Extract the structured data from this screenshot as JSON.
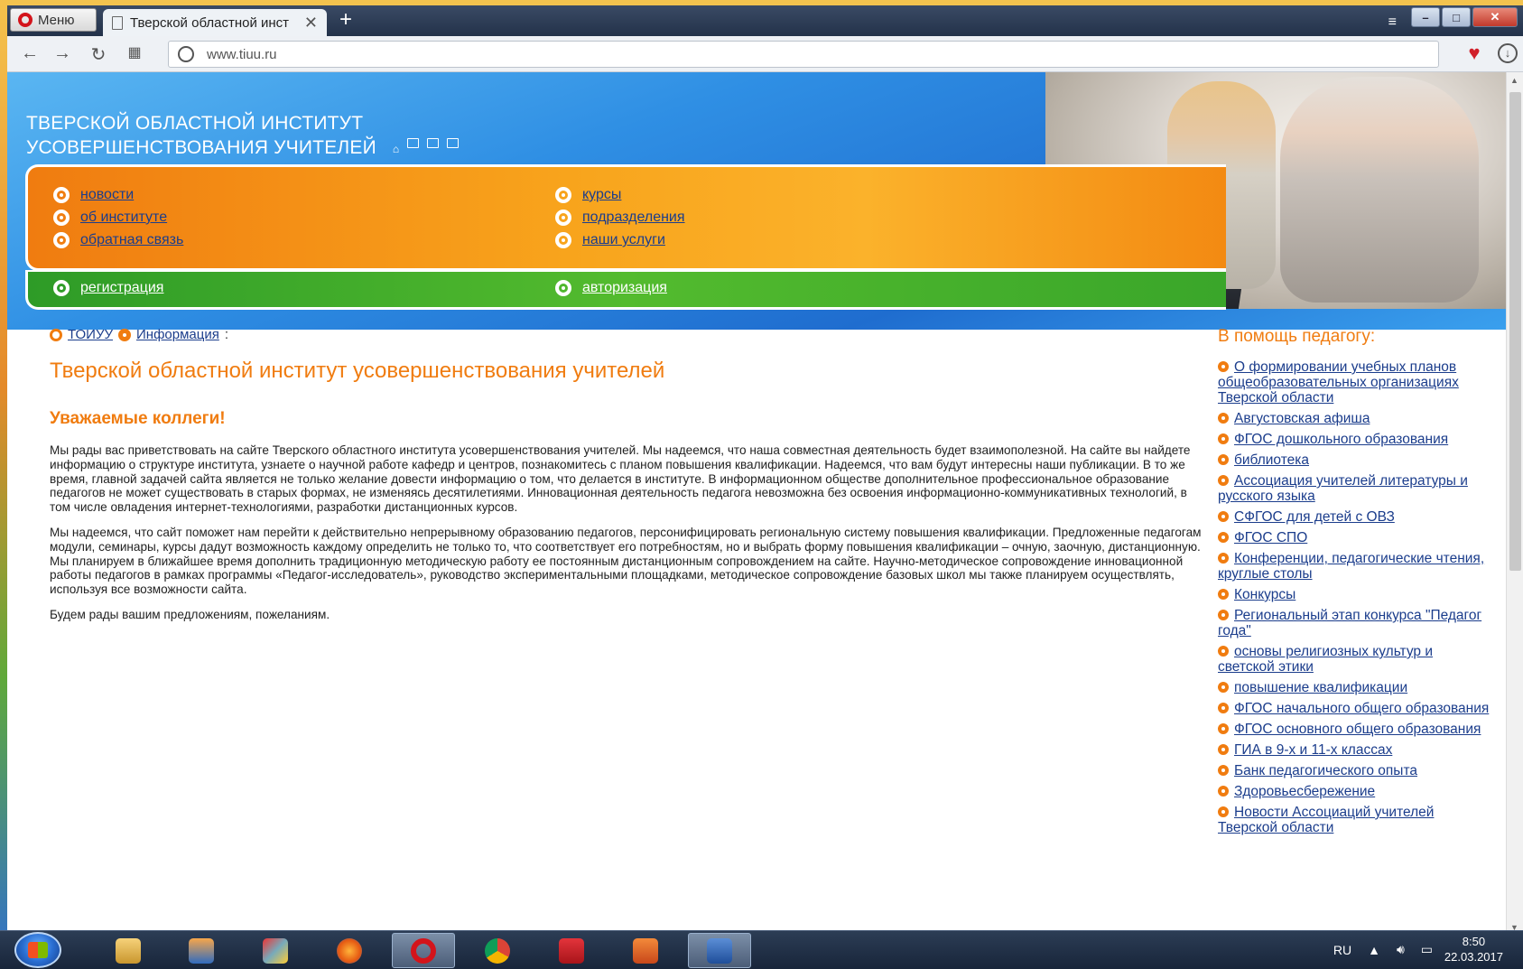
{
  "browser": {
    "menu_label": "Меню",
    "tab_title": "Тверской областной инст",
    "address": "www.tiuu.ru"
  },
  "header": {
    "title_line1": "ТВЕРСКОЙ ОБЛАСТНОЙ ИНСТИТУТ",
    "title_line2": "УСОВЕРШЕНСТВОВАНИЯ УЧИТЕЛЕЙ",
    "menu_left": [
      "новости",
      "об институте",
      "обратная связь"
    ],
    "menu_right": [
      "курсы",
      "подразделения",
      "наши услуги"
    ],
    "register": "регистрация",
    "login": "авторизация"
  },
  "breadcrumb": {
    "home": "ТОИУУ",
    "section": "Информация",
    "sep": ":"
  },
  "main": {
    "title": "Тверской областной институт усовершенствования учителей",
    "greeting": "Уважаемые коллеги!",
    "paragraphs": [
      "Мы рады вас приветствовать на сайте Тверского областного института усовершенствования учителей. Мы надеемся, что наша совместная деятельность будет взаимополезной. На сайте вы найдете информацию о структуре института, узнаете о научной работе кафедр и центров, познакомитесь с планом повышения квалификации. Надеемся, что вам будут интересны наши публикации. В то же время, главной задачей сайта является не только желание довести информацию о том, что делается в институте. В информационном обществе дополнительное профессиональное образование педагогов не может существовать в старых формах, не изменяясь десятилетиями. Инновационная деятельность педагога невозможна без освоения информационно-коммуникативных технологий, в том числе овладения интернет-технологиями, разработки дистанционных курсов.",
      "Мы надеемся, что сайт поможет нам перейти к действительно непрерывному образованию педагогов, персонифицировать региональную систему повышения квалификации. Предложенные педагогам модули, семинары, курсы дадут возможность каждому определить не только то, что соответствует его потребностям, но и выбрать форму повышения квалификации – очную, заочную, дистанционную. Мы планируем в ближайшее время дополнить традиционную методическую работу ее постоянным дистанционным сопровождением на сайте. Научно-методическое сопровождение инновационной работы педагогов в рамках программы «Педагог-исследователь», руководство экспериментальными площадками, методическое сопровождение базовых школ мы также планируем осуществлять, используя все возможности сайта.",
      "Будем рады вашим предложениям, пожеланиям."
    ]
  },
  "sidebar": {
    "title": "В помощь педагогу:",
    "items": [
      "О формировании учебных планов общеобразовательных организациях Тверской области",
      "Августовская афиша",
      "ФГОС дошкольного образования",
      "библиотека",
      "Ассоциация учителей литературы и русского языка",
      "СФГОС для детей с ОВЗ",
      "ФГОС СПО",
      "Конференции, педагогические чтения, круглые столы",
      "Конкурсы",
      "Региональный этап конкурса \"Педагог года\"",
      "основы религиозных культур и светской этики",
      "повышение квалификации",
      "ФГОС начального общего образования",
      "ФГОС основного общего образования",
      "ГИА в 9-х и 11-х классах",
      "Банк педагогического опыта",
      "Здоровьесбережение",
      "Новости Ассоциаций учителей Тверской области"
    ]
  },
  "taskbar": {
    "lang": "RU",
    "time": "8:50",
    "date": "22.03.2017"
  },
  "colors": {
    "accent_orange": "#f07c10",
    "link_blue": "#1b3d8c",
    "header_blue": "#2f8fe4",
    "band_green": "#53bb2e"
  }
}
